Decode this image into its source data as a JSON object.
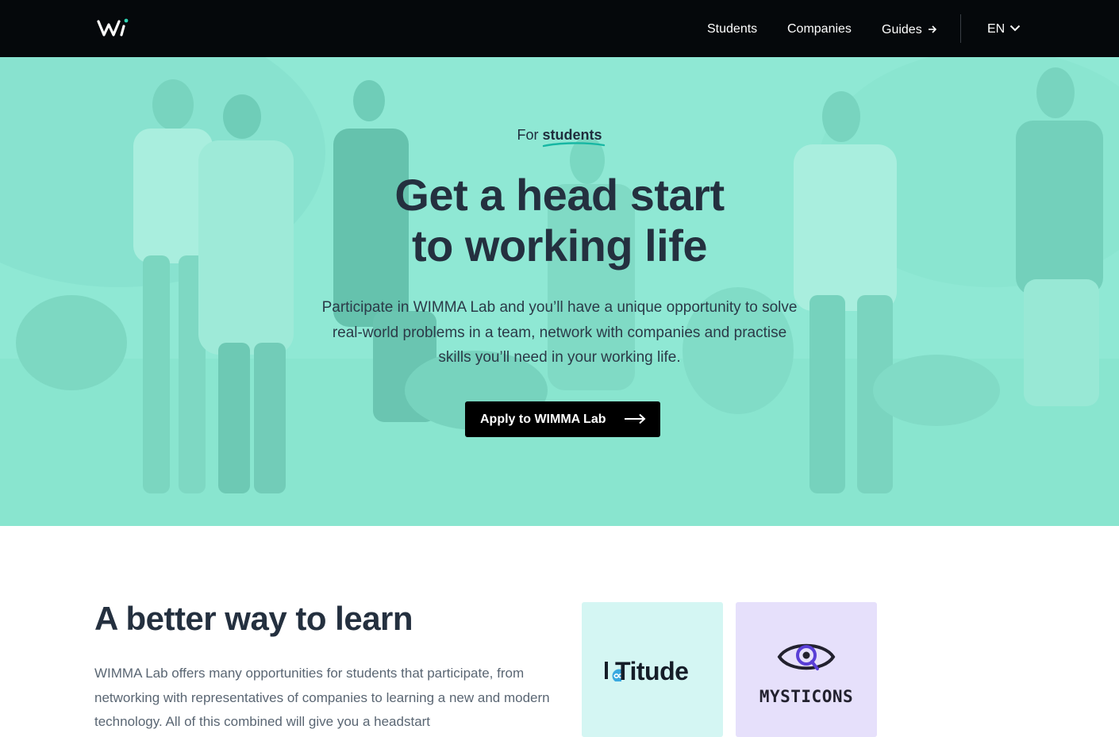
{
  "nav": {
    "logo_alt": "Wi",
    "links": [
      {
        "label": "Students"
      },
      {
        "label": "Companies"
      },
      {
        "label": "Guides"
      }
    ],
    "language": "EN"
  },
  "hero": {
    "kicker_prefix": "For",
    "kicker_highlight": "students",
    "title_line1": "Get a head start",
    "title_line2": "to working life",
    "description": "Participate in WIMMA Lab and you’ll have a unique opportunity to solve real-world problems in a team, network with companies and practise skills you’ll need in your working life.",
    "cta_label": "Apply to WIMMA Lab"
  },
  "section": {
    "title": "A better way to learn",
    "text": "WIMMA Lab offers many opportunities for students that participate, from networking with representatives of companies to learning a new and modern technology. All of this combined will give you a headstart"
  },
  "cards": [
    {
      "name": "IoTitude",
      "logo_text": "Titude",
      "bg": "#d4f6f3"
    },
    {
      "name": "MYSTICONS",
      "logo_text": "MYSTICONS",
      "bg": "#e6e0fb"
    }
  ],
  "colors": {
    "nav_bg": "#05080b",
    "hero_tint": "#8fe8d5",
    "accent_teal": "#17b7a3",
    "heading": "#24303f",
    "cta_bg": "#000000"
  }
}
